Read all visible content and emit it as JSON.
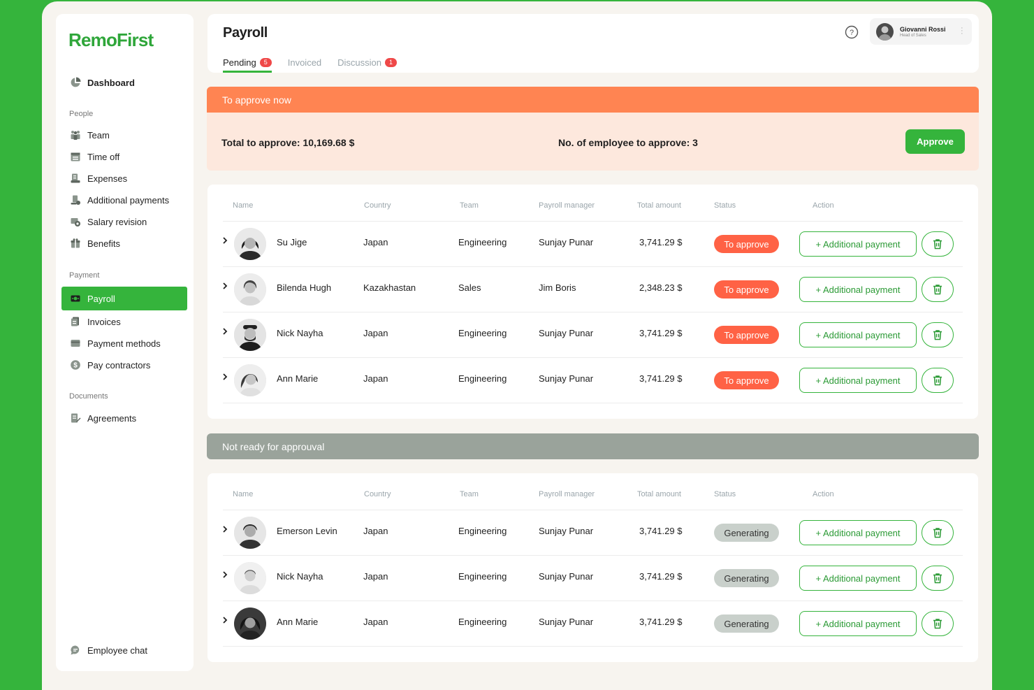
{
  "brand": {
    "name": "RemoFirst",
    "color": "#35b43c"
  },
  "sidebar": {
    "dashboard": "Dashboard",
    "sections": {
      "people": "People",
      "payment": "Payment",
      "documents": "Documents"
    },
    "people_items": [
      "Team",
      "Time off",
      "Expenses",
      "Additional payments",
      "Salary revision",
      "Benefits"
    ],
    "payment_items": [
      "Payroll",
      "Invoices",
      "Payment methods",
      "Pay contractors"
    ],
    "documents_items": [
      "Agreements"
    ],
    "footer": "Employee chat"
  },
  "header": {
    "title": "Payroll",
    "tabs": [
      {
        "label": "Pending",
        "badge": "5"
      },
      {
        "label": "Invoiced",
        "badge": ""
      },
      {
        "label": "Discussion",
        "badge": "1"
      }
    ],
    "user": {
      "name": "Giovanni Rossi",
      "role": "Head of Sales"
    }
  },
  "approve_section": {
    "title": "To approve now",
    "total": "Total to approve: 10,169.68 $",
    "employees": "No. of employee to approve: 3",
    "approve_label": "Approve",
    "color": "#ff8452"
  },
  "columns": [
    "Name",
    "Country",
    "Team",
    "Payroll manager",
    "Total amount",
    "Status",
    "Action"
  ],
  "add_payment_label": "+ Additional payment",
  "pending_rows": [
    {
      "name": "Su Jige",
      "country": "Japan",
      "team": "Engineering",
      "manager": "Sunjay Punar",
      "amount": "3,741.29 $",
      "status": "To approve"
    },
    {
      "name": "Bilenda Hugh",
      "country": "Kazakhastan",
      "team": "Sales",
      "manager": "Jim Boris",
      "amount": "2,348.23 $",
      "status": "To approve"
    },
    {
      "name": "Nick Nayha",
      "country": "Japan",
      "team": "Engineering",
      "manager": "Sunjay Punar",
      "amount": "3,741.29 $",
      "status": "To approve"
    },
    {
      "name": "Ann Marie",
      "country": "Japan",
      "team": "Engineering",
      "manager": "Sunjay Punar",
      "amount": "3,741.29 $",
      "status": "To approve"
    }
  ],
  "not_ready_section": {
    "title": "Not ready for approuval"
  },
  "not_ready_rows": [
    {
      "name": "Emerson Levin",
      "country": "Japan",
      "team": "Engineering",
      "manager": "Sunjay Punar",
      "amount": "3,741.29 $",
      "status": "Generating"
    },
    {
      "name": "Nick Nayha",
      "country": "Japan",
      "team": "Engineering",
      "manager": "Sunjay Punar",
      "amount": "3,741.29 $",
      "status": "Generating"
    },
    {
      "name": "Ann Marie",
      "country": "Japan",
      "team": "Engineering",
      "manager": "Sunjay Punar",
      "amount": "3,741.29 $",
      "status": "Generating"
    }
  ]
}
